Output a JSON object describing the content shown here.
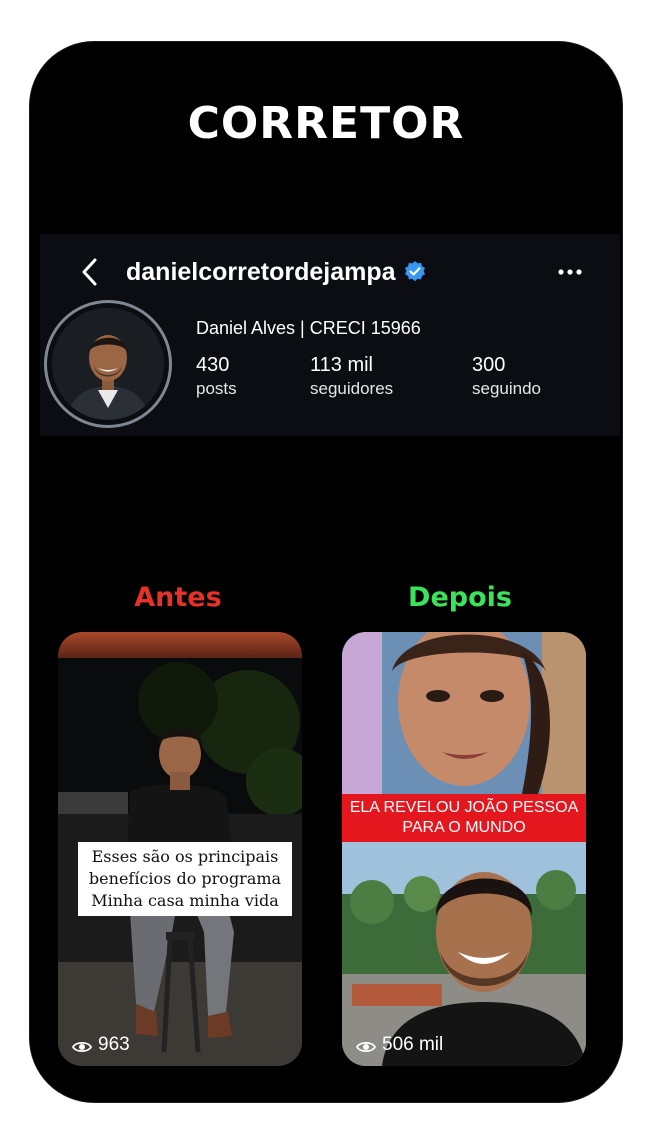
{
  "header": {
    "title": "CORRETOR"
  },
  "profile": {
    "username": "danielcorretordejampa",
    "display_name": "Daniel Alves | CRECI 15966",
    "stats": [
      {
        "value": "430",
        "label": "posts"
      },
      {
        "value": "113 mil",
        "label": "seguidores"
      },
      {
        "value": "300",
        "label": "seguindo"
      }
    ],
    "icons": [
      "back-icon",
      "verified-icon",
      "more-icon"
    ]
  },
  "comparison": {
    "before_label": "Antes",
    "after_label": "Depois",
    "before_label_color": "#e63128",
    "after_label_color": "#3be35a",
    "before_reel": {
      "caption": "Esses são os principais benefícios do programa Minha casa minha vida",
      "views": "963"
    },
    "after_reel": {
      "headline": "ELA REVELOU JOÃO PESSOA PARA O MUNDO",
      "views": "506 mil"
    }
  },
  "colors": {
    "background": "#000000",
    "verified": "#3897f0",
    "headline_bg": "#e4161e"
  }
}
